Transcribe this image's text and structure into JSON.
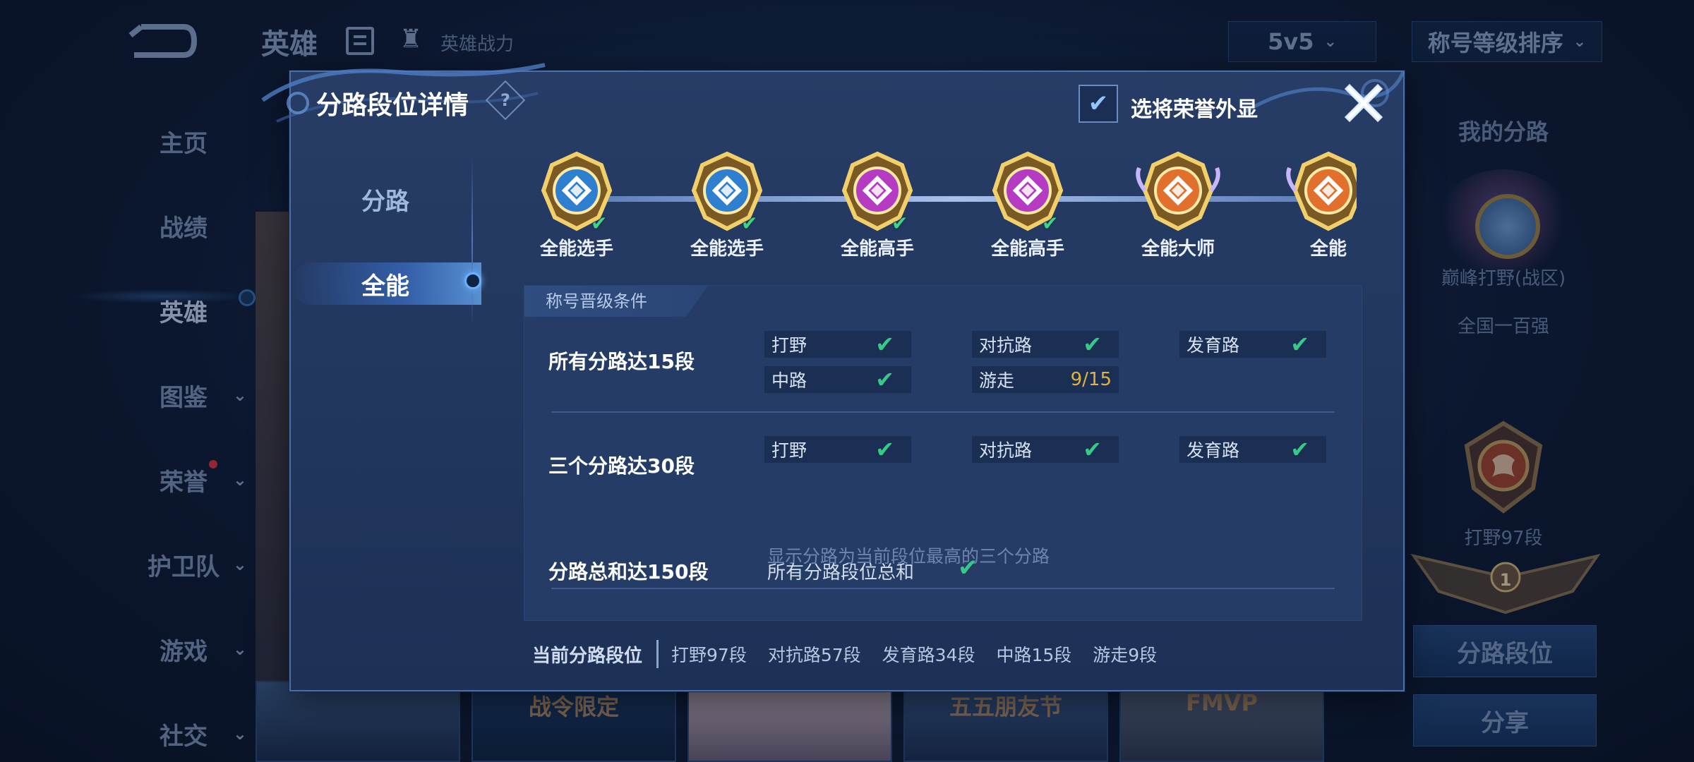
{
  "background": {
    "title": "英雄",
    "power_label": "英雄战力",
    "mode": "5v5",
    "sort": "称号等级排序",
    "nav": [
      {
        "label": "主页",
        "chevron": false
      },
      {
        "label": "战绩",
        "chevron": false
      },
      {
        "label": "英雄",
        "chevron": false,
        "active": true
      },
      {
        "label": "图鉴",
        "chevron": true
      },
      {
        "label": "荣誉",
        "chevron": true,
        "dot": true
      },
      {
        "label": "护卫队",
        "chevron": true
      },
      {
        "label": "游戏",
        "chevron": true
      },
      {
        "label": "社交",
        "chevron": true
      }
    ],
    "hero_cards": [
      "",
      "战令限定",
      "",
      "五五朋友节",
      "FMVP"
    ],
    "right": {
      "my_lane_title": "我的分路",
      "peak_name": "巅峰打野(战区)",
      "peak_rank": "全国一百强",
      "jungle_rank": "打野97段",
      "plate_number": "1",
      "lane_button": "分路段位",
      "share_button": "分享"
    }
  },
  "modal": {
    "title": "分路段位详情",
    "help_glyph": "?",
    "honor_display_label": "选将荣誉外显",
    "honor_display_checked": true,
    "tabs": [
      {
        "label": "分路",
        "active": false
      },
      {
        "label": "全能",
        "active": true
      }
    ],
    "badges": [
      {
        "name": "全能选手",
        "color": "#2f7fd0",
        "done": true
      },
      {
        "name": "全能选手",
        "color": "#2f7fd0",
        "done": true
      },
      {
        "name": "全能高手",
        "color": "#b43bc2",
        "done": true
      },
      {
        "name": "全能高手",
        "color": "#b43bc2",
        "done": true
      },
      {
        "name": "全能大师",
        "color": "#e0702c",
        "done": false
      },
      {
        "name": "全能",
        "color": "#e0702c",
        "done": false
      }
    ],
    "conditions_header": "称号晋级条件",
    "conditions": [
      {
        "title": "所有分路达15段",
        "lanes": [
          {
            "name": "打野",
            "status": "done"
          },
          {
            "name": "对抗路",
            "status": "done"
          },
          {
            "name": "发育路",
            "status": "done"
          },
          {
            "name": "中路",
            "status": "done"
          },
          {
            "name": "游走",
            "progress": "9/15"
          }
        ]
      },
      {
        "title": "三个分路达30段",
        "lanes": [
          {
            "name": "打野",
            "status": "done"
          },
          {
            "name": "对抗路",
            "status": "done"
          },
          {
            "name": "发育路",
            "status": "done"
          }
        ],
        "note": "显示分路为当前段位最高的三个分路"
      },
      {
        "title": "分路总和达150段",
        "label": "所有分路段位总和",
        "status": "done"
      }
    ],
    "current": {
      "label": "当前分路段位",
      "items": [
        "打野97段",
        "对抗路57段",
        "发育路34段",
        "中路15段",
        "游走9段"
      ]
    },
    "check_glyph": "✔"
  },
  "colors": {
    "check": "#39c987",
    "progress": "#e0b240",
    "panel": "#253d66"
  }
}
